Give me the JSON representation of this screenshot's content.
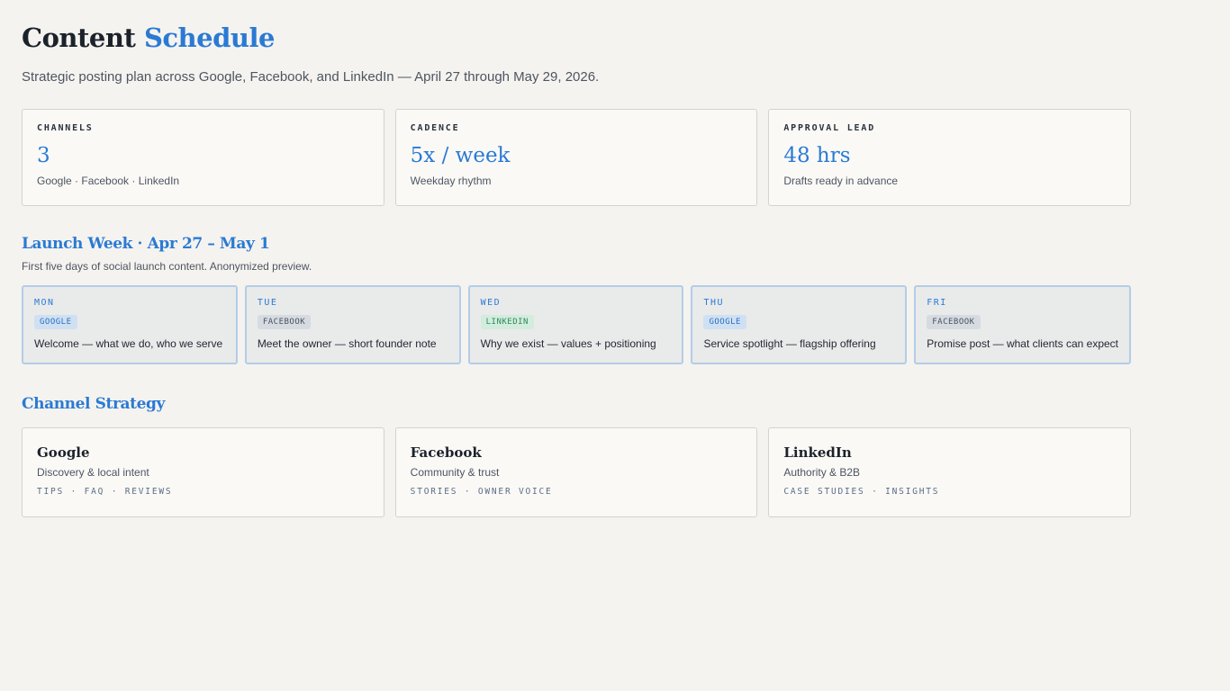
{
  "header": {
    "title_main": "Content",
    "title_accent": "Schedule",
    "subtitle": "Strategic posting plan across Google, Facebook, and LinkedIn — April 27 through May 29, 2026."
  },
  "stats": [
    {
      "label": "CHANNELS",
      "value": "3",
      "desc": "Google · Facebook · LinkedIn"
    },
    {
      "label": "CADENCE",
      "value": "5x / week",
      "desc": "Weekday rhythm"
    },
    {
      "label": "APPROVAL LEAD",
      "value": "48 hrs",
      "desc": "Drafts ready in advance"
    }
  ],
  "launch": {
    "title": "Launch Week · Apr 27 – May 1",
    "subtitle": "First five days of social launch content. Anonymized preview.",
    "days": [
      {
        "day": "MON",
        "channel": "GOOGLE",
        "text": "Welcome — what we do, who we serve"
      },
      {
        "day": "TUE",
        "channel": "FACEBOOK",
        "text": "Meet the owner — short founder note"
      },
      {
        "day": "WED",
        "channel": "LINKEDIN",
        "text": "Why we exist — values + positioning"
      },
      {
        "day": "THU",
        "channel": "GOOGLE",
        "text": "Service spotlight — flagship offering"
      },
      {
        "day": "FRI",
        "channel": "FACEBOOK",
        "text": "Promise post — what clients can expect"
      }
    ]
  },
  "strategy": {
    "title": "Channel Strategy",
    "channels": [
      {
        "name": "Google",
        "desc": "Discovery & local intent",
        "tags": "TIPS · FAQ · REVIEWS"
      },
      {
        "name": "Facebook",
        "desc": "Community & trust",
        "tags": "STORIES · OWNER VOICE"
      },
      {
        "name": "LinkedIn",
        "desc": "Authority & B2B",
        "tags": "CASE STUDIES · INSIGHTS"
      }
    ]
  },
  "colors": {
    "accent": "#2a7ad4",
    "background": "#f5f3ef",
    "chip_google": "#cfe0f3",
    "chip_facebook": "#d6dbe2",
    "chip_linkedin": "#d2ecdd"
  }
}
